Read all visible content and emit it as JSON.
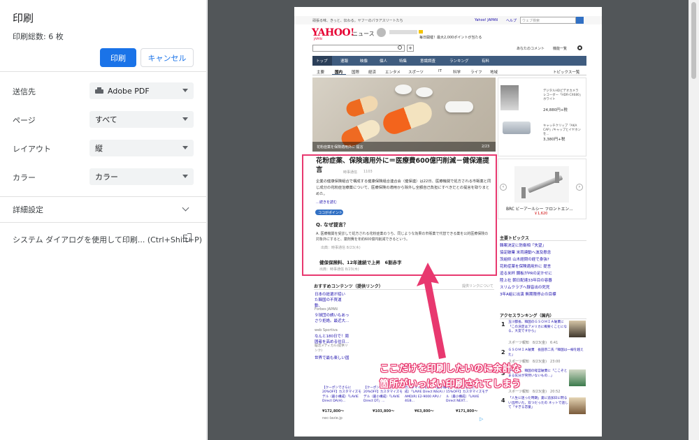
{
  "print_panel": {
    "title": "印刷",
    "sheet_count": "印刷総数: 6 枚",
    "print_button": "印刷",
    "cancel_button": "キャンセル",
    "destination_label": "送信先",
    "destination_value": "Adobe PDF",
    "pages_label": "ページ",
    "pages_value": "すべて",
    "layout_label": "レイアウト",
    "layout_value": "縦",
    "color_label": "カラー",
    "color_value": "カラー",
    "more_settings": "詳細設定",
    "system_dialog": "システム ダイアログを使用して印刷... (Ctrl+Shift+P)"
  },
  "preview": {
    "topbar_text": "頑張る味、きっと、伝わる。ヤフーのパラアスリートたち",
    "topbar_links": [
      "Yahoo! JAPAN",
      "ヘルプ"
    ],
    "search_placeholder": "ウェブ検索",
    "logo": "YAHOO!",
    "logo_sub": "JAPAN",
    "logo_news": "ニュース",
    "promo": "毎日開催！最大2,000ポイントが当たる",
    "header_right": [
      "あなたのコメント",
      "機能一覧"
    ],
    "nav_tabs": [
      "トップ",
      "速報",
      "映像",
      "個人",
      "特集",
      "意識調査",
      "ランキング",
      "有料"
    ],
    "sub_tabs": [
      "主要",
      "国内",
      "国際",
      "経済",
      "エンタメ",
      "スポーツ",
      "IT",
      "科学",
      "ライフ",
      "地域"
    ],
    "topics_list": "トピックス一覧",
    "photo_caption": "花粉症薬を保険適用外に 提言",
    "photo_meta": "2/23",
    "article": {
      "title": "花粉症薬、保険適用外に＝医療費600億円削減－健保連提言",
      "source": "時事通信",
      "comments": "1103",
      "body": "企業の健康保険組合で構成する健康保険組合連合会（健保連）は22日、医療機関で処方される市販薬と同じ成分の花粉症治療薬について、医療保険の適用から除外し全額自己負担にすべきだとの提言を取りまとめた。",
      "read_more": "…続きを読む",
      "point_tag": "ココがポイント",
      "q_title": "Q. なぜ提言？",
      "a_text": "A. 医療機関を受診して処方される花粉症薬のうち、同じような効果の市販薬で代替できる薬を公的医療保険の対象外にすると、薬剤費を年約600億円削減できるという。",
      "a_source": "出典：時事通信 8/23(木)",
      "related": "健保保険料、12年連続で上昇　6割赤字",
      "related_source": "出典：時事通信 8/23(木)"
    },
    "recommended": {
      "title": "おすすめコンテンツ（提供リンク）",
      "note": "提供リンクについて",
      "items": [
        {
          "text": "日本の総選が招いた韓国の不買運動、",
          "src": "Forbes JAPAN"
        },
        {
          "text": "９球団の誘いもあっさり拒絶。最近大...",
          "src": "web Sportiva"
        },
        {
          "text": "なんと180日で！周囲者を高める往日...",
          "src": "脳活メディカル(提供リンク)"
        },
        {
          "text": "世界で最も楽しい国",
          "src": ""
        }
      ]
    },
    "ads": [
      {
        "text": "【クーポンでさらに20%OFF】カスタマイズモデル（最小構成）「LAVIE Direct DA(H)...",
        "price": "¥172,800～"
      },
      {
        "text": "【クーポンでさらに20%OFF】カスタマイズモデル（最小構成）「LAVIE Direct DT」...",
        "price": "¥103,800～"
      },
      {
        "text": "カスタマイズモデル（最小構成）「LAVIE Direct NS(A) / AMD(R) E2-9000 APU / 4GB...",
        "price": "¥63,800～"
      },
      {
        "text": "【クーポンでさらに15%OFF】カスタマイズモデル（最小構成）「LAVIE Direct NEXT...",
        "price": "¥171,800～"
      }
    ],
    "ad_footer": "nec-lavie.jp",
    "side_ads": [
      {
        "text": "デジタルHDビデオカメラ レコーダー「HDR-CX680」ホワイト",
        "price": "24,880円+税"
      },
      {
        "text": "キャッチクリップ「AKA CAP」/キャップとイヤホンを...",
        "price": "3,380円+税"
      }
    ],
    "brc_product": {
      "text": "BRC ビーアールシー フロントエン...",
      "price": "￥1,620"
    },
    "major_topics": {
      "title": "主要トピックス",
      "items": [
        "韓案決定に防衛相「失望」",
        "協定破棄 米両連動へ波及懸念",
        "茨組県 山木経問の経で身強?",
        "花粉症薬を保険適用外に 提言",
        "迫る米杯 鋼板がPRの足かせに",
        "陸上社 朝日配達33年目の容器",
        "スリムクラブへ録音出の死死",
        "3年A組に出演 無期限停止の目標"
      ]
    },
    "ranking": {
      "title": "アクセスランキング（国内）",
      "items": [
        {
          "rank": "1",
          "text": "玉川都長、韓国のＧＳＯＭＩＡ破棄に「この決定はアメリカに概要くことになる。大変ですから」",
          "meta": "スポーツ報知　8/23(金)　6:41"
        },
        {
          "rank": "2",
          "text": "ＧＳＯＭＩＡ破棄　長田宗二氏「韓国は一線を越えた」",
          "meta": "スポーツ報知　8/23(金)　23:00"
        },
        {
          "rank": "3",
          "text": "中学教員、韓国の経営破棄に「ここぞとまる気分が突然いないもの...」",
          "meta": "スポーツ報知　8/23(金)　20:52"
        },
        {
          "rank": "4",
          "text": "「人生に迷った時期」妻に追加日に明るい出所いた。双つだったの ネットで話して「すぎる恋童」",
          "meta": ""
        }
      ]
    }
  },
  "annotation": {
    "line1": "ここだけを印刷したいのに余計な",
    "line2": "箇所がいっぱい印刷されてしまう",
    "color": "#e8386f"
  }
}
